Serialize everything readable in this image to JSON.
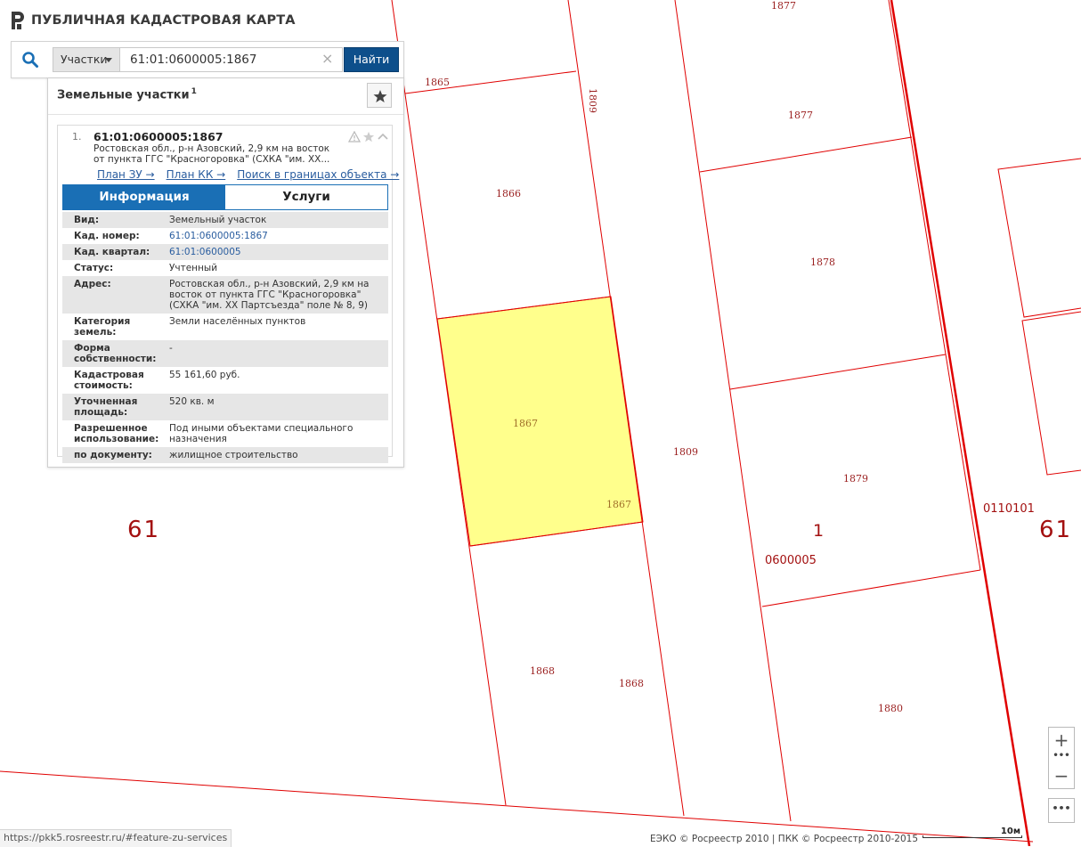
{
  "app": {
    "title": "ПУБЛИЧНАЯ КАДАСТРОВАЯ КАРТА"
  },
  "search": {
    "type_label": "Участки",
    "query": "61:01:0600005:1867",
    "clear_symbol": "×",
    "find_label": "Найти"
  },
  "panel": {
    "title": "Земельные участки",
    "count": "1",
    "result": {
      "index": "1.",
      "cadastral_number": "61:01:0600005:1867",
      "address_short": "Ростовская обл., р-н Азовский, 2,9 км на восток от пункта ГГС \"Красногоровка\" (СХКА \"им. ХХ...",
      "links": [
        "План ЗУ →",
        "План КК →",
        "Поиск в границах объекта →"
      ],
      "tabs": {
        "info": "Информация",
        "services": "Услуги"
      },
      "attributes": [
        {
          "key": "Вид:",
          "value": "Земельный участок"
        },
        {
          "key": "Кад. номер:",
          "value": "61:01:0600005:1867"
        },
        {
          "key": "Кад. квартал:",
          "value": "61:01:0600005"
        },
        {
          "key": "Статус:",
          "value": "Учтенный"
        },
        {
          "key": "Адрес:",
          "value": "Ростовская обл., р-н Азовский, 2,9 км на восток от пункта ГГС \"Красногоровка\" (СХКА \"им. ХХ Партсъезда\" поле № 8, 9)"
        },
        {
          "key": "Категория земель:",
          "value": "Земли населённых пунктов"
        },
        {
          "key": "Форма собственности:",
          "value": "-"
        },
        {
          "key": "Кадастровая стоимость:",
          "value": "55 161,60 руб."
        },
        {
          "key": "Уточненная площадь:",
          "value": "520 кв. м"
        },
        {
          "key": "Разрешенное использование:",
          "value": "Под иными объектами специального назначения"
        },
        {
          "key": "по документу:",
          "value": "жилищное строительство"
        }
      ]
    }
  },
  "map": {
    "parcel_labels": [
      "1877",
      "1865",
      "1809",
      "1877",
      "1866",
      "1878",
      "1867",
      "1867",
      "1809",
      "1879",
      "1868",
      "1868",
      "1880"
    ],
    "district_left": "61",
    "district_right": "61",
    "region": "1",
    "quarter": "0600005",
    "quarter_right": "0110101",
    "highlight_color": "#ffff8c",
    "boundary_color": "#e00000"
  },
  "controls": {
    "zoom_in": "+",
    "zoom_dots": "•••",
    "zoom_out": "−",
    "more": "•••"
  },
  "footer": {
    "status_url": "https://pkk5.rosreestr.ru/#feature-zu-services",
    "copyright": "ЕЭКО © Росреестр 2010 | ПКК © Росреестр 2010-2015",
    "scale_label": "10м"
  }
}
